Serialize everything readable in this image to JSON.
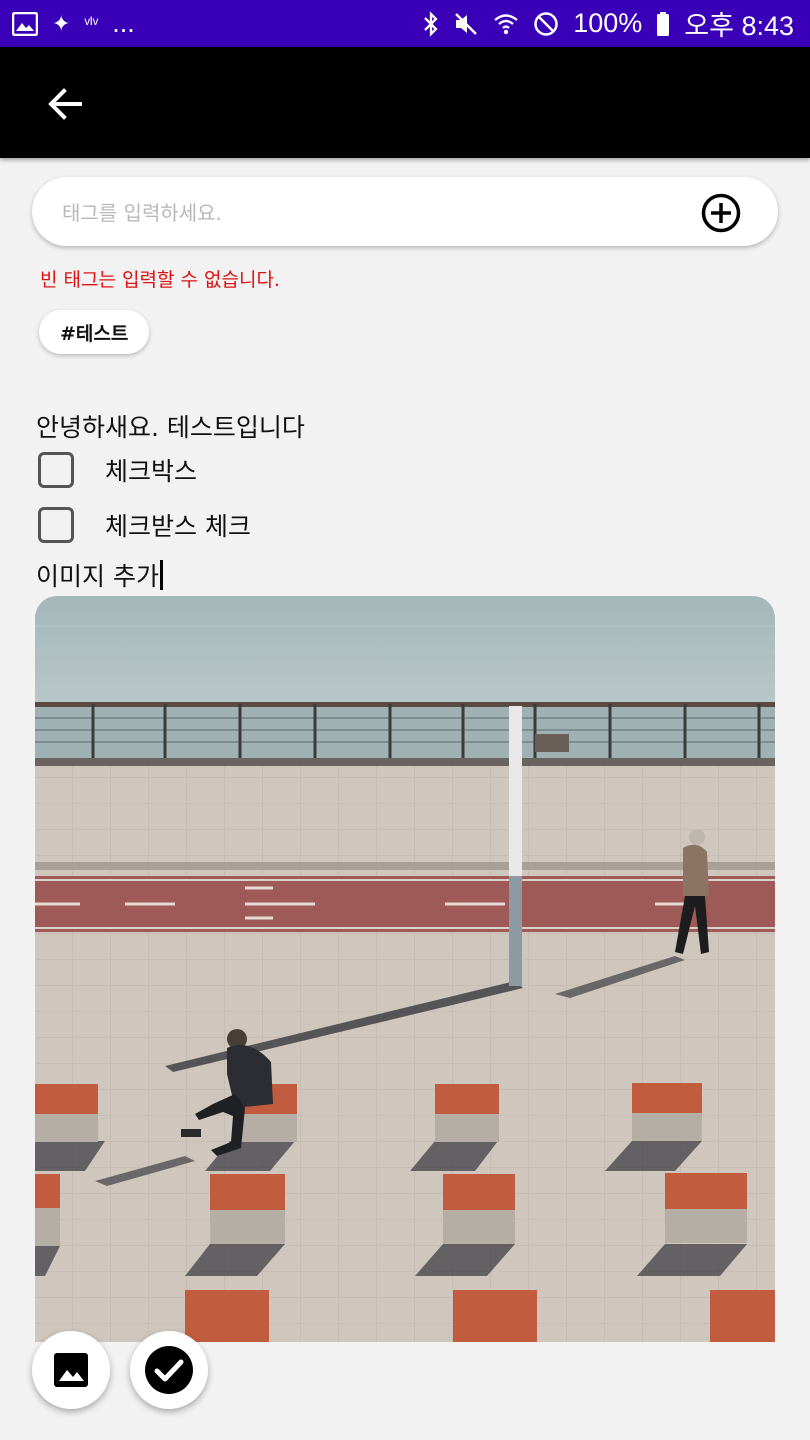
{
  "status_bar": {
    "notification_icons": [
      "image-icon",
      "sparkle-icon",
      "voicemail-icon"
    ],
    "overflow": "...",
    "system_icons": [
      "bluetooth-icon",
      "mute-icon",
      "wifi-icon",
      "do-not-disturb-icon"
    ],
    "battery": "100%",
    "time": "오후 8:43",
    "color": "#3a00b8"
  },
  "app_bar": {
    "back_icon": "arrow-back-icon",
    "color": "#000000"
  },
  "tag_input": {
    "placeholder": "태그를 입력하세요.",
    "value": "",
    "add_icon": "add-circle-icon"
  },
  "error_message": "빈 태그는 입력할 수 없습니다.",
  "tags": [
    "#테스트"
  ],
  "editor": {
    "text_line": "안녕하새요. 테스트입니다",
    "checkboxes": [
      {
        "label": "체크박스",
        "checked": false
      },
      {
        "label": "체크받스 체크",
        "checked": false
      }
    ],
    "last_line": "이미지 추가",
    "image": "photo-riverside-promenade"
  },
  "fabs": [
    {
      "icon": "image-icon",
      "action": "add image"
    },
    {
      "icon": "check-circle-icon",
      "action": "confirm"
    }
  ]
}
